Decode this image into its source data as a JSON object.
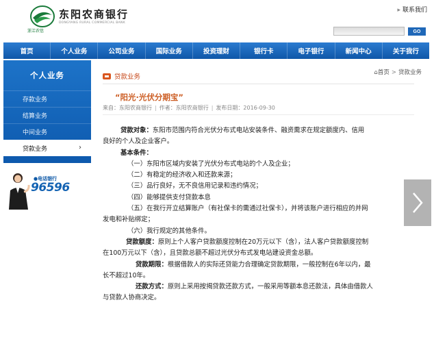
{
  "header": {
    "bank_name": "东阳农商银行",
    "bank_name_en": "DONGYANG RURAL COMMERCIAL BANK",
    "logo_caption": "浙江农信",
    "contact_link": "联系我们",
    "search_value": "",
    "search_button": "GO"
  },
  "nav": {
    "items": [
      "首页",
      "个人业务",
      "公司业务",
      "国际业务",
      "投资理财",
      "银行卡",
      "电子银行",
      "新闻中心",
      "关于我行"
    ]
  },
  "sidebar": {
    "title": "个人业务",
    "items": [
      {
        "label": "存款业务"
      },
      {
        "label": "结算业务"
      },
      {
        "label": "中间业务"
      },
      {
        "label": "贷款业务",
        "active": true,
        "chevron": "›"
      }
    ]
  },
  "hotline": {
    "label": "●电话银行",
    "number": "96596"
  },
  "main": {
    "section_label": "贷款业务",
    "breadcrumb": {
      "home": "首页",
      "sep": ">",
      "current": "贷款业务"
    },
    "title": "“阳光·光伏分期宝”",
    "meta": {
      "source": "来自：东阳农商银行",
      "author": "作者：东阳农商银行",
      "date": "发布日期：2016-09-30",
      "sep": "|"
    },
    "paragraphs": {
      "p1_label": "贷款对象：",
      "p1_text_a": "东阳市范围内符合光伏分布式电站安装条件、融资需求在规定额度内、信用",
      "p1_text_b": "良好的个人及企业客户。",
      "p2_label": "基本条件：",
      "c1": "（一）东阳市区域内安装了光伏分布式电站的个人及企业；",
      "c2": "（二）有稳定的经济收入和还款来源；",
      "c3": "（三）品行良好，无不良信用记录和违约情况；",
      "c4": "（四）能够提供支付贷款本息",
      "c5a": "（五）在我行开立结算账户（有社保卡的需通过社保卡），并将该账户进行相应的并网",
      "c5b": "发电和补贴绑定；",
      "c6": "（六）我行规定的其他条件。",
      "p3_label": "贷款额度：",
      "p3_text_a": "原则上个人客户贷款额度控制在20万元以下（含），法人客户贷款额度控制",
      "p3_text_b": "在100万元以下（含），且贷款总额不超过光伏分布式发电站建设资金总额。",
      "p4_label": "贷款期限：",
      "p4_text_a": "根据借款人的实际还贷能力合理确定贷款期限，一般控制在6年以内，最",
      "p4_text_b": "长不超过10年。",
      "p5_label": "还款方式：",
      "p5_text_a": "原则上采用按揭贷款还款方式，一般采用等额本息还款法，具体由借款人",
      "p5_text_b": "与贷款人协商决定。"
    }
  },
  "colors": {
    "nav_blue": "#1467bd",
    "accent_orange": "#cc5d23",
    "logo_green": "#1a7a3a"
  }
}
